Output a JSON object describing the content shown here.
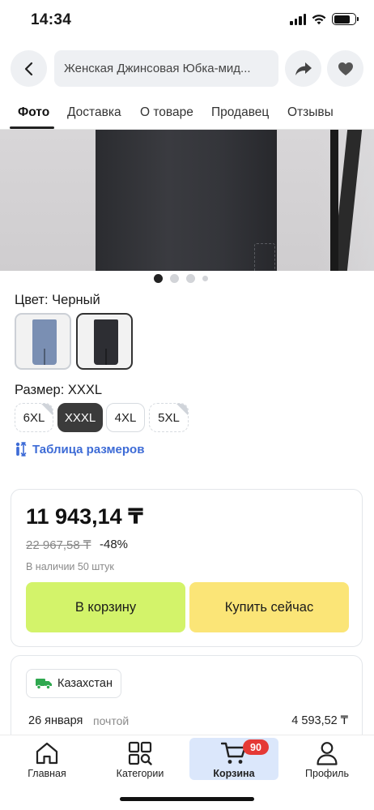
{
  "status": {
    "time": "14:34"
  },
  "header": {
    "title": "Женская Джинсовая Юбка-мид..."
  },
  "tabs": [
    {
      "label": "Фото",
      "active": true
    },
    {
      "label": "Доставка",
      "active": false
    },
    {
      "label": "О товаре",
      "active": false
    },
    {
      "label": "Продавец",
      "active": false
    },
    {
      "label": "Отзывы",
      "active": false
    }
  ],
  "gallery": {
    "current_index": 1,
    "dot_count": 4
  },
  "color": {
    "label": "Цвет: Черный",
    "options": [
      {
        "name": "blue-denim",
        "swatch": "#7a8fb3",
        "selected": false
      },
      {
        "name": "black-denim",
        "swatch": "#2d2e33",
        "selected": true
      }
    ]
  },
  "size": {
    "label": "Размер: XXXL",
    "options": [
      {
        "label": "6XL",
        "selected": false,
        "dim": true
      },
      {
        "label": "XXXL",
        "selected": true,
        "dim": false
      },
      {
        "label": "4XL",
        "selected": false,
        "dim": false
      },
      {
        "label": "5XL",
        "selected": false,
        "dim": true
      }
    ],
    "chart_link": "Таблица размеров"
  },
  "price": {
    "current": "11 943,14 ₸",
    "old": "22 967,58 ₸",
    "discount": "-48%",
    "stock": "В наличии 50 штук"
  },
  "actions": {
    "add_to_cart": "В корзину",
    "buy_now": "Купить сейчас"
  },
  "delivery": {
    "country": "Казахстан",
    "date": "26 января",
    "method": "почтой",
    "price": "4 593,52 ₸"
  },
  "nav": {
    "items": [
      {
        "label": "Главная",
        "icon": "home-icon",
        "active": false
      },
      {
        "label": "Категории",
        "icon": "categories-icon",
        "active": false
      },
      {
        "label": "Корзина",
        "icon": "cart-icon",
        "active": true,
        "badge": "90"
      },
      {
        "label": "Профиль",
        "icon": "profile-icon",
        "active": false
      }
    ]
  },
  "colors": {
    "accent_link": "#3d6bd6",
    "cart_button": "#d3f36a",
    "buy_button": "#fbe577",
    "badge": "#e53935",
    "active_nav_bg": "#dbe7fb"
  }
}
